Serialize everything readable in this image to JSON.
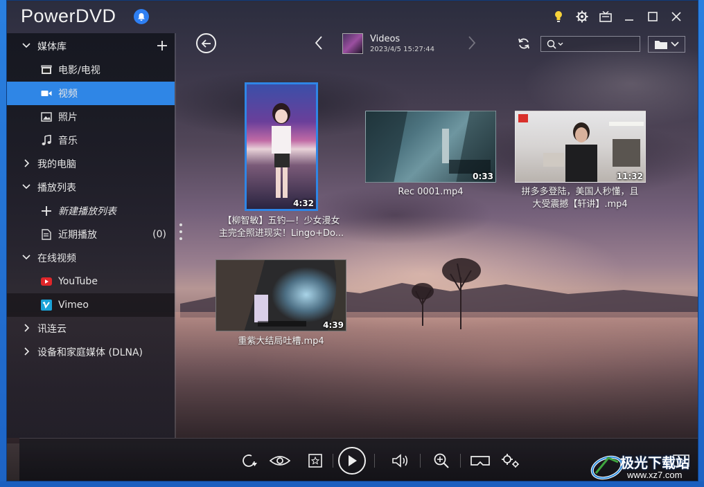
{
  "app": {
    "title": "PowerDVD"
  },
  "sidebar": {
    "media_library": "媒体库",
    "movies_tv": "电影/电视",
    "videos": "视频",
    "photos": "照片",
    "music": "音乐",
    "my_computer": "我的电脑",
    "playlists": "播放列表",
    "new_playlist": "新建播放列表",
    "recent": "近期播放",
    "recent_count": "(0)",
    "online_video": "在线视频",
    "youtube": "YouTube",
    "vimeo": "Vimeo",
    "xunlian_cloud": "讯连云",
    "dlna": "设备和家庭媒体 (DLNA)"
  },
  "header": {
    "folder_title": "Videos",
    "folder_date": "2023/4/5 15:27:44",
    "search_value": ""
  },
  "media": [
    {
      "name_line1": "【柳智敏】五钓—！少女漫女",
      "name_line2": "主完全照进现实！Lingo+Do...",
      "duration": "4:32"
    },
    {
      "name_line1": "Rec 0001.mp4",
      "name_line2": "",
      "duration": "0:33"
    },
    {
      "name_line1": "拼多多登陆，美国人秒懂，且",
      "name_line2": "大受震撼【轩讲】.mp4",
      "duration": "11:32"
    },
    {
      "name_line1": "重紫大结局吐槽.mp4",
      "name_line2": "",
      "duration": "4:39"
    }
  ],
  "watermark": {
    "text": "极光下载站",
    "url": "www.xz7.com"
  },
  "colors": {
    "accent": "#2f86e6",
    "sidebar_bg": "#16181f",
    "youtube": "#e0262a",
    "vimeo": "#1aa3d8"
  }
}
